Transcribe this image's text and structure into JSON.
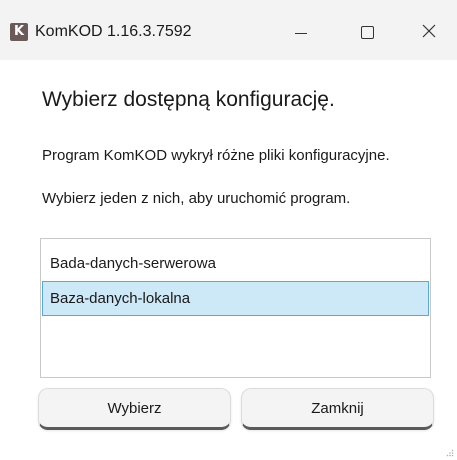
{
  "window": {
    "app_icon_letter": "K",
    "title": "KomKOD 1.16.3.7592",
    "controls": {
      "minimize_icon": "minimize-icon",
      "maximize_icon": "maximize-icon",
      "close_icon": "close-icon"
    }
  },
  "dialog": {
    "heading": "Wybierz dostępną konfigurację.",
    "paragraph1": "Program KomKOD wykrył różne pliki konfiguracyjne.",
    "paragraph2": "Wybierz jeden z nich, aby uruchomić program.",
    "configs": [
      {
        "label": "Bada-danych-serwerowa",
        "selected": false
      },
      {
        "label": "Baza-danych-lokalna",
        "selected": true
      }
    ],
    "buttons": {
      "select": "Wybierz",
      "close": "Zamknij"
    }
  },
  "colors": {
    "selection_fill": "#cde8f7",
    "selection_border": "#57a8dc",
    "titlebar": "#f3f3f3"
  }
}
